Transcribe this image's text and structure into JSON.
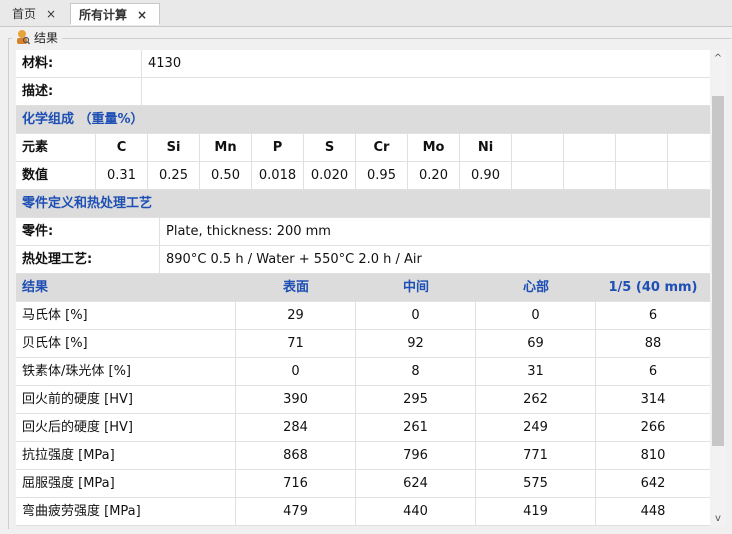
{
  "tabs": [
    {
      "label": "首页",
      "close": "×"
    },
    {
      "label": "所有计算",
      "close": "×"
    }
  ],
  "group": {
    "title": "结果",
    "icon": "user-search-icon"
  },
  "material": {
    "label": "材料:",
    "value": "4130"
  },
  "description": {
    "label": "描述:",
    "value": ""
  },
  "chem": {
    "title": "化学组成 （重量%）",
    "header_label": "元素",
    "value_label": "数值",
    "elements": [
      "C",
      "Si",
      "Mn",
      "P",
      "S",
      "Cr",
      "Mo",
      "Ni"
    ],
    "values": [
      "0.31",
      "0.25",
      "0.50",
      "0.018",
      "0.020",
      "0.95",
      "0.20",
      "0.90"
    ]
  },
  "part": {
    "title": "零件定义和热处理工艺",
    "part_label": "零件:",
    "part_value": "Plate, thickness: 200 mm",
    "ht_label": "热处理工艺:",
    "ht_value": "890°C 0.5 h / Water + 550°C 2.0 h / Air"
  },
  "results": {
    "headers": [
      "结果",
      "表面",
      "中间",
      "心部",
      "1/5 (40 mm)"
    ],
    "rows": [
      [
        "马氏体 [%]",
        "29",
        "0",
        "0",
        "6"
      ],
      [
        "贝氏体 [%]",
        "71",
        "92",
        "69",
        "88"
      ],
      [
        "铁素体/珠光体 [%]",
        "0",
        "8",
        "31",
        "6"
      ],
      [
        "回火前的硬度 [HV]",
        "390",
        "295",
        "262",
        "314"
      ],
      [
        "回火后的硬度 [HV]",
        "284",
        "261",
        "249",
        "266"
      ],
      [
        "抗拉强度 [MPa]",
        "868",
        "796",
        "771",
        "810"
      ],
      [
        "屈服强度 [MPa]",
        "716",
        "624",
        "575",
        "642"
      ],
      [
        "弯曲疲劳强度 [MPa]",
        "479",
        "440",
        "419",
        "448"
      ]
    ]
  },
  "scrollbar": {
    "up": "^",
    "down": "v"
  },
  "colors": {
    "section_bg": "#dcdcdc",
    "accent": "#1e4fb4"
  }
}
